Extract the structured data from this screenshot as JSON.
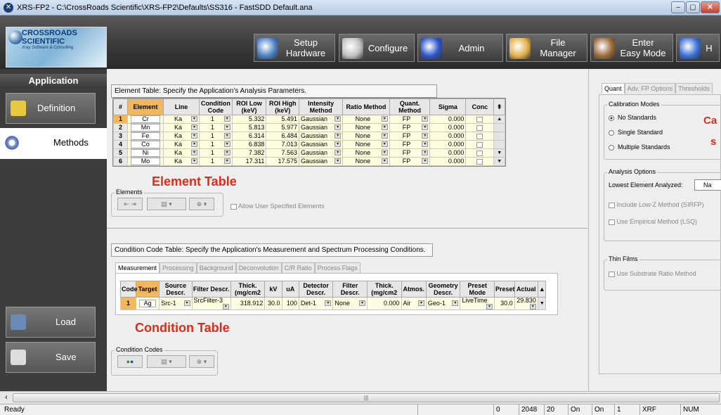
{
  "window": {
    "title": "XRS-FP2 - C:\\CrossRoads Scientific\\XRS-FP2\\Defaults\\SS316 - FastSDD Default.ana",
    "buttons": [
      "–",
      "▢",
      "✕"
    ]
  },
  "logo": {
    "line1": "CROSSROADS",
    "line2": "SCIENTIFIC",
    "sub": "Xray Software & Consulting"
  },
  "toolbar": [
    {
      "label": "Setup\nHardware",
      "icon": "setup-hardware-icon",
      "color": "#4a7fc0"
    },
    {
      "label": "Configure",
      "icon": "configure-icon",
      "color": "#c0c0c0"
    },
    {
      "label": "Admin",
      "icon": "admin-icon",
      "color": "#2a55c8"
    },
    {
      "label": "File\nManager",
      "icon": "file-manager-icon",
      "color": "#e2b04a"
    },
    {
      "label": "Enter\nEasy Mode",
      "icon": "easy-mode-icon",
      "color": "#9b6a3a"
    },
    {
      "label": "H",
      "icon": "help-icon",
      "color": "#3a6ed8"
    }
  ],
  "sidebar": {
    "header": "Application",
    "items": [
      {
        "label": "Definition",
        "icon": "definition-icon",
        "color": "#e8c840",
        "active": false
      },
      {
        "label": "Methods",
        "icon": "methods-icon",
        "color": "#8fa8d8",
        "active": true
      }
    ],
    "bottom": [
      {
        "label": "Load",
        "icon": "load-icon",
        "color": "#6a8ab8"
      },
      {
        "label": "Save",
        "icon": "save-icon",
        "color": "#dddddd"
      }
    ]
  },
  "element_table": {
    "header": "Element Table:  Specify the Application's Analysis Parameters.",
    "columns": [
      "#",
      "Element",
      "Line",
      "Condition Code",
      "ROI Low (keV)",
      "ROI High (keV)",
      "Intensity Method",
      "Ratio Method",
      "Quant. Method",
      "Sigma",
      "Conc"
    ],
    "rows": [
      {
        "n": "1",
        "el": "Cr",
        "line": "Ka",
        "cond": "1",
        "lo": "5.332",
        "hi": "5.491",
        "int": "Gaussian",
        "ratio": "None",
        "quant": "FP",
        "sigma": "0.000"
      },
      {
        "n": "2",
        "el": "Mn",
        "line": "Ka",
        "cond": "1",
        "lo": "5.813",
        "hi": "5.977",
        "int": "Gaussian",
        "ratio": "None",
        "quant": "FP",
        "sigma": "0.000"
      },
      {
        "n": "3",
        "el": "Fe",
        "line": "Ka",
        "cond": "1",
        "lo": "6.314",
        "hi": "6.484",
        "int": "Gaussian",
        "ratio": "None",
        "quant": "FP",
        "sigma": "0.000"
      },
      {
        "n": "4",
        "el": "Co",
        "line": "Ka",
        "cond": "1",
        "lo": "6.838",
        "hi": "7.013",
        "int": "Gaussian",
        "ratio": "None",
        "quant": "FP",
        "sigma": "0.000"
      },
      {
        "n": "5",
        "el": "Ni",
        "line": "Ka",
        "cond": "1",
        "lo": "7.382",
        "hi": "7.563",
        "int": "Gaussian",
        "ratio": "None",
        "quant": "FP",
        "sigma": "0.000"
      },
      {
        "n": "6",
        "el": "Mo",
        "line": "Ka",
        "cond": "1",
        "lo": "17.311",
        "hi": "17.575",
        "int": "Gaussian",
        "ratio": "None",
        "quant": "FP",
        "sigma": "0.000"
      }
    ],
    "elements_group": "Elements",
    "allow_user": "Allow User Specified Elements",
    "overlay_label": "Element Table"
  },
  "condition_table": {
    "header": "Condition Code Table:  Specify the Application's Measurement and Spectrum Processing Conditions.",
    "tabs": [
      "Measurement",
      "Processing",
      "Background",
      "Deconvolution",
      "C/R Ratio",
      "Process Flags"
    ],
    "columns": [
      "Code",
      "Target",
      "Source Descr.",
      "Filter Descr.",
      "Thick. (mg/cm2",
      "kV",
      "uA",
      "Detector Descr.",
      "Filter Descr.",
      "Thick. (mg/cm2",
      "Atmos.",
      "Geometry Descr.",
      "Preset Mode",
      "Preset",
      "Actual"
    ],
    "row": {
      "code": "1",
      "target": "Ag",
      "source": "Src-1",
      "filter": "SrcFilter-3",
      "thick": "318.912",
      "kv": "30.0",
      "ua": "100",
      "det": "Det-1",
      "dfilter": "None",
      "dthick": "0.000",
      "atmos": "Air",
      "geom": "Geo-1",
      "mode": "LiveTime",
      "preset": "30.0",
      "actual": "29.830"
    },
    "codes_group": "Condition Codes",
    "overlay_label": "Condition Table"
  },
  "right": {
    "tabs": [
      "Quant",
      "Adv. FP Options",
      "Thresholds"
    ],
    "calibration_title": "Calibration Modes",
    "calibration": [
      "No Standards",
      "Single Standard",
      "Multiple Standards"
    ],
    "analysis_title": "Analysis Options",
    "lowest_label": "Lowest Element Analyzed:",
    "lowest_value": "Na",
    "options": [
      "Include Low-Z Method (SIRFP)",
      "Use Empirical Method (LSQ)"
    ],
    "thin_title": "Thin Films",
    "thin_option": "Use Substrate Ratio Method",
    "overlay_1": "Ca",
    "overlay_2": "s"
  },
  "scrollbar": {
    "left_arrow": "‹",
    "grip": "|||"
  },
  "statusbar": {
    "ready": "Ready",
    "cells": [
      "0",
      "2048",
      "20",
      "On",
      "On",
      "1",
      "XRF",
      "NUM"
    ]
  }
}
